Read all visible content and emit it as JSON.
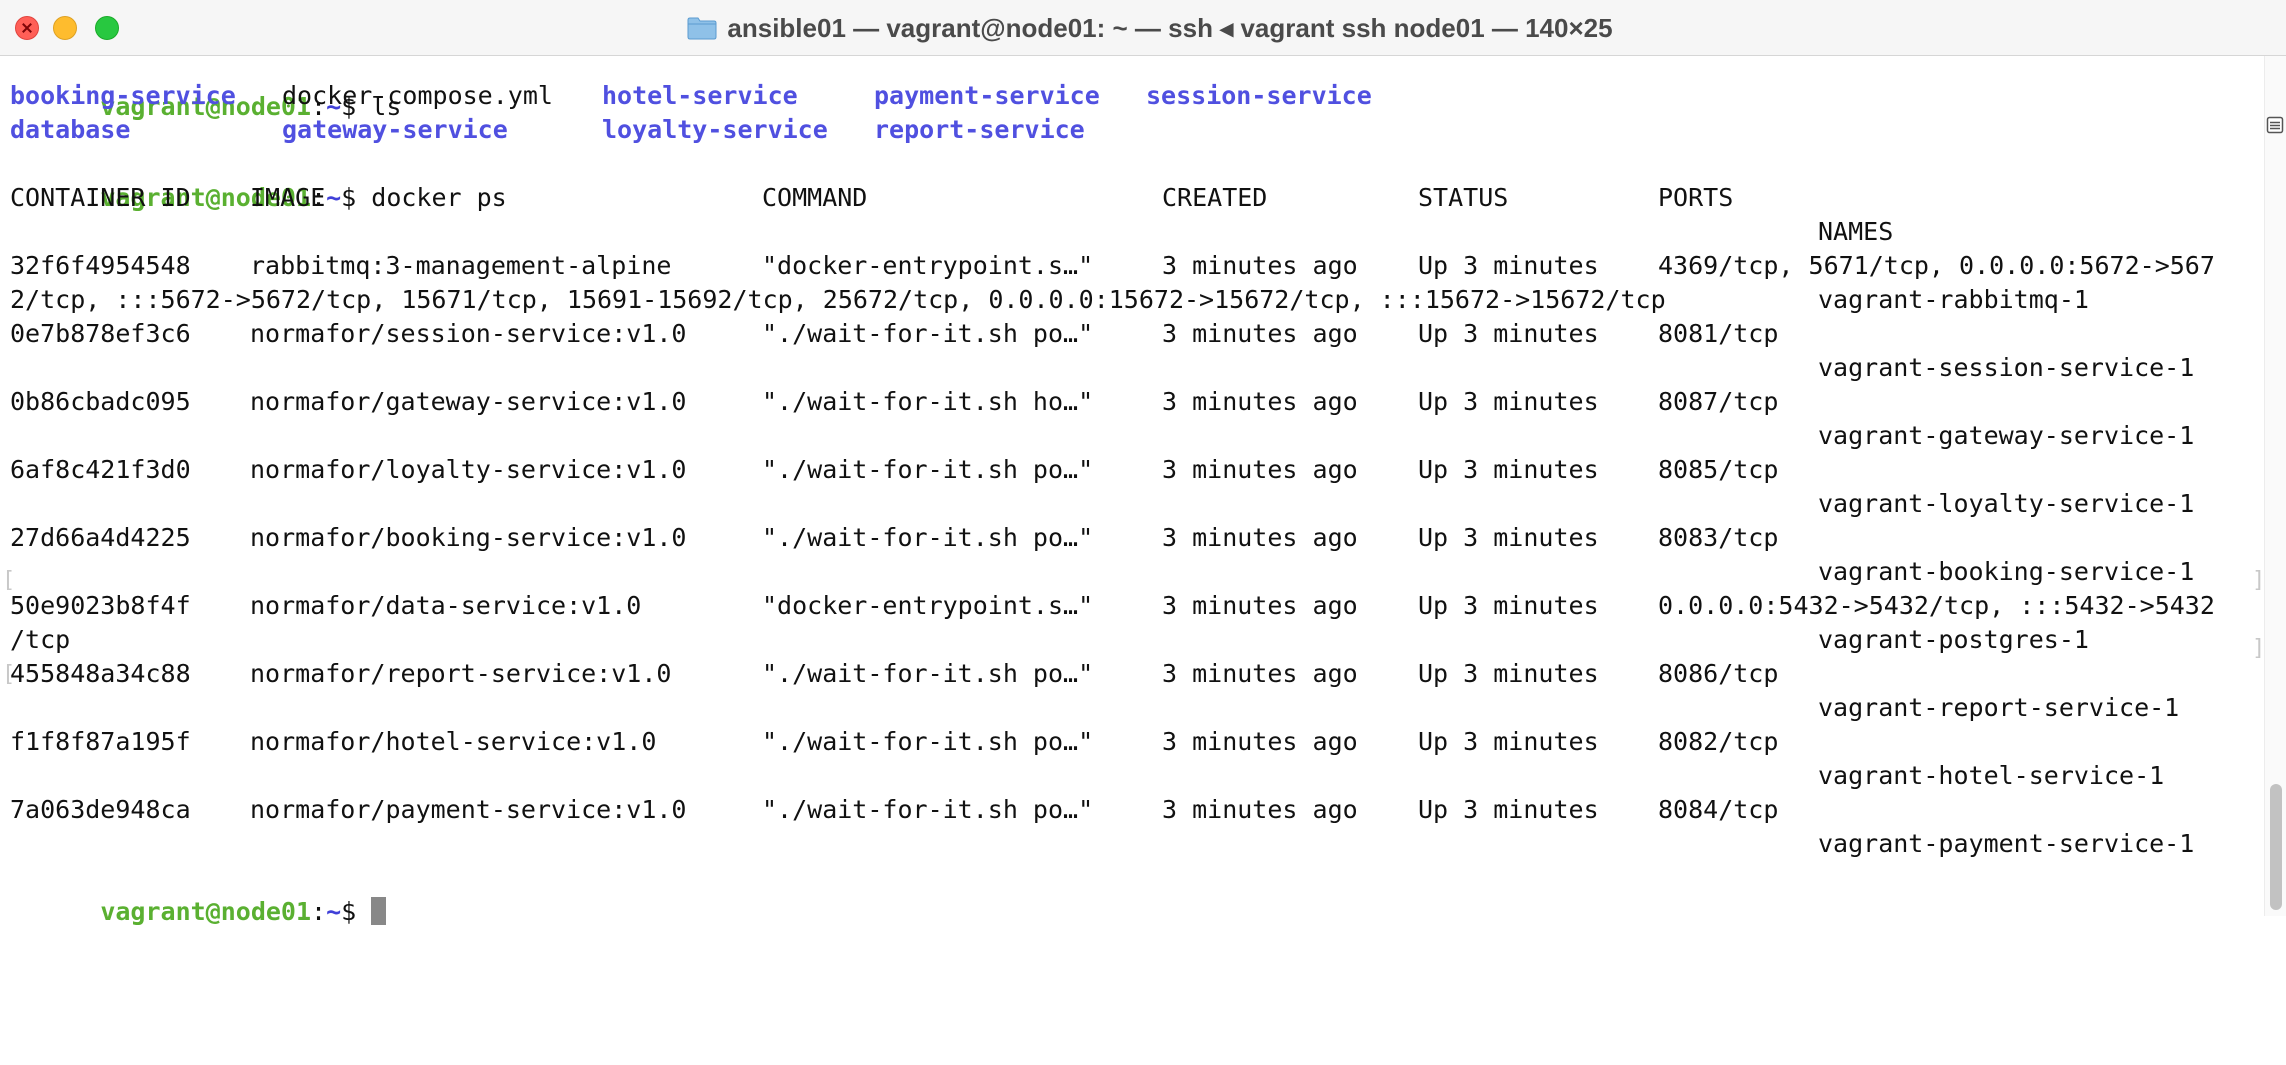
{
  "window": {
    "title": "ansible01 — vagrant@node01: ~ — ssh ◂ vagrant ssh node01 — 140×25",
    "traffic_colors": {
      "close": "#ff5f57",
      "minimize": "#febc2e",
      "maximize": "#28c840"
    }
  },
  "terminal": {
    "colors": {
      "prompt_user": "#5ab031",
      "prompt_path": "#4040d8",
      "directory": "#5050e0",
      "text": "#111111"
    },
    "prompt": {
      "user_host": "vagrant@node01",
      "sep": ":",
      "path": "~",
      "symbol": "$ "
    },
    "commands": {
      "ls": "ls",
      "docker_ps": "docker ps"
    },
    "ls_output": {
      "row1": [
        "booking-service",
        "docker-compose.yml",
        "hotel-service",
        "payment-service",
        "session-service"
      ],
      "row2": [
        "database",
        "gateway-service",
        "loyalty-service",
        "report-service"
      ]
    },
    "headers": {
      "container_id": "CONTAINER ID",
      "image": "IMAGE",
      "command": "COMMAND",
      "created": "CREATED",
      "status": "STATUS",
      "ports": "PORTS",
      "names": "NAMES"
    },
    "rows": [
      {
        "id": "32f6f4954548",
        "image": "rabbitmq:3-management-alpine",
        "command": "\"docker-entrypoint.s…\"",
        "created": "3 minutes ago",
        "status": "Up 3 minutes",
        "ports": "4369/tcp, 5671/tcp, 0.0.0.0:5672->567",
        "ports_wrap": "2/tcp, :::5672->5672/tcp, 15671/tcp, 15691-15692/tcp, 25672/tcp, 0.0.0.0:15672->15672/tcp, :::15672->15672/tcp",
        "name": "vagrant-rabbitmq-1"
      },
      {
        "id": "0e7b878ef3c6",
        "image": "normafor/session-service:v1.0",
        "command": "\"./wait-for-it.sh po…\"",
        "created": "3 minutes ago",
        "status": "Up 3 minutes",
        "ports": "8081/tcp",
        "name": "vagrant-session-service-1"
      },
      {
        "id": "0b86cbadc095",
        "image": "normafor/gateway-service:v1.0",
        "command": "\"./wait-for-it.sh ho…\"",
        "created": "3 minutes ago",
        "status": "Up 3 minutes",
        "ports": "8087/tcp",
        "name": "vagrant-gateway-service-1"
      },
      {
        "id": "6af8c421f3d0",
        "image": "normafor/loyalty-service:v1.0",
        "command": "\"./wait-for-it.sh po…\"",
        "created": "3 minutes ago",
        "status": "Up 3 minutes",
        "ports": "8085/tcp",
        "name": "vagrant-loyalty-service-1"
      },
      {
        "id": "27d66a4d4225",
        "image": "normafor/booking-service:v1.0",
        "command": "\"./wait-for-it.sh po…\"",
        "created": "3 minutes ago",
        "status": "Up 3 minutes",
        "ports": "8083/tcp",
        "name": "vagrant-booking-service-1"
      },
      {
        "id": "50e9023b8f4f",
        "image": "normafor/data-service:v1.0",
        "command": "\"docker-entrypoint.s…\"",
        "created": "3 minutes ago",
        "status": "Up 3 minutes",
        "ports": "0.0.0.0:5432->5432/tcp, :::5432->5432",
        "ports_wrap": "/tcp",
        "name": "vagrant-postgres-1"
      },
      {
        "id": "455848a34c88",
        "image": "normafor/report-service:v1.0",
        "command": "\"./wait-for-it.sh po…\"",
        "created": "3 minutes ago",
        "status": "Up 3 minutes",
        "ports": "8086/tcp",
        "name": "vagrant-report-service-1"
      },
      {
        "id": "f1f8f87a195f",
        "image": "normafor/hotel-service:v1.0",
        "command": "\"./wait-for-it.sh po…\"",
        "created": "3 minutes ago",
        "status": "Up 3 minutes",
        "ports": "8082/tcp",
        "name": "vagrant-hotel-service-1"
      },
      {
        "id": "7a063de948ca",
        "image": "normafor/payment-service:v1.0",
        "command": "\"./wait-for-it.sh po…\"",
        "created": "3 minutes ago",
        "status": "Up 3 minutes",
        "ports": "8084/tcp",
        "name": "vagrant-payment-service-1"
      }
    ]
  }
}
